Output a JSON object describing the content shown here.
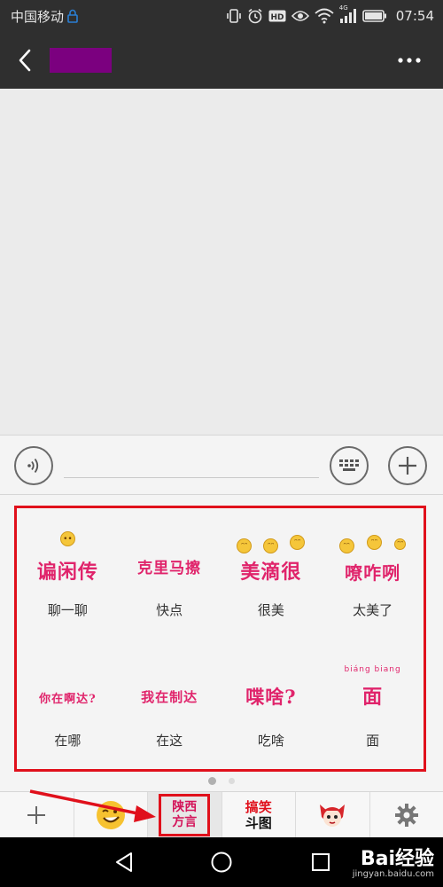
{
  "status_bar": {
    "carrier": "中国移动",
    "network": "4G",
    "time": "07:54",
    "icons": [
      "lock-icon",
      "vibrate-icon",
      "alarm-icon",
      "hd-icon",
      "eye-icon",
      "wifi-icon",
      "signal-icon",
      "battery-icon"
    ]
  },
  "app_bar": {
    "title": "",
    "back_icon": "chevron-left-icon",
    "more_icon": "more-dots-icon"
  },
  "input_bar": {
    "voice_icon": "voice-icon",
    "keyboard_icon": "keyboard-icon",
    "plus_icon": "plus-icon",
    "text_value": ""
  },
  "stickers": [
    {
      "art_text": "谝闲传",
      "label": "聊一聊"
    },
    {
      "art_text": "克里马擦",
      "label": "快点"
    },
    {
      "art_text": "美滴很",
      "label": "很美"
    },
    {
      "art_text": "嘹咋咧",
      "label": "太美了"
    },
    {
      "art_text": "你在啊达?",
      "label": "在哪"
    },
    {
      "art_text": "我在制达",
      "label": "在这"
    },
    {
      "art_text": "喋啥?",
      "label": "吃啥"
    },
    {
      "art_text": "面",
      "pinyin": "biáng biang",
      "label": "面"
    }
  ],
  "pagination": {
    "current": 1,
    "total": 2
  },
  "tabs": {
    "add_icon": "plus-icon",
    "emoji_icon": "emoji-face-icon",
    "dialect_line1": "陕西",
    "dialect_line2": "方言",
    "funny_line1": "搞笑",
    "funny_line2": "斗图",
    "character_icon": "cartoon-fox-icon",
    "settings_icon": "gear-icon"
  },
  "nav_bar": {
    "back_icon": "triangle-back-icon",
    "home_icon": "circle-home-icon",
    "recents_icon": "square-recents-icon"
  },
  "watermark": {
    "main": "Bai经验",
    "sub": "jingyan.baidu.com"
  },
  "colors": {
    "accent_red": "#e0101b",
    "sticker_pink": "#e0246b",
    "dark_bar": "#2f2f2f",
    "redacted_title": "#7b007f"
  }
}
